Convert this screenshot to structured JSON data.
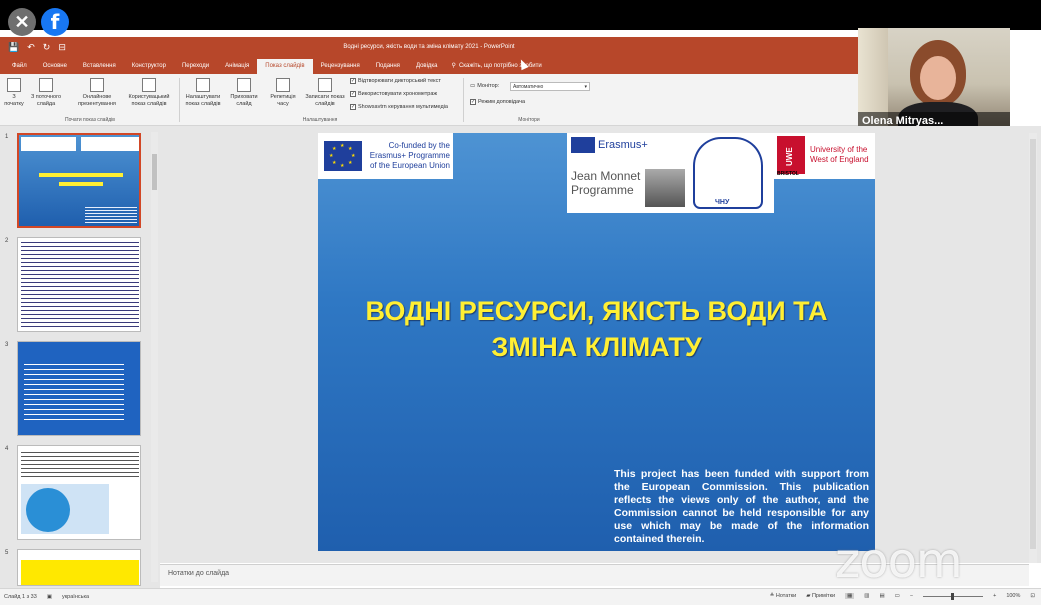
{
  "overlay": {
    "close_glyph": "✕",
    "facebook_glyph": "f"
  },
  "titlebar": {
    "quick_access": [
      "💾",
      "↶",
      "↻",
      "⊟"
    ],
    "document_title": "Водні ресурси, якість води та зміна клімату 2021  -  PowerPoint"
  },
  "ribbon_tabs": [
    {
      "label": "Файл"
    },
    {
      "label": "Основне"
    },
    {
      "label": "Вставлення"
    },
    {
      "label": "Конструктор"
    },
    {
      "label": "Переходи"
    },
    {
      "label": "Анімація"
    },
    {
      "label": "Показ слайдів",
      "active": true
    },
    {
      "label": "Рецензування"
    },
    {
      "label": "Подання"
    },
    {
      "label": "Довідка"
    }
  ],
  "tell_me": {
    "icon": "lightbulb-icon",
    "label": "Скажіть, що потрібно зробити"
  },
  "ribbon": {
    "start_group": {
      "buttons": [
        "З початку",
        "З поточного слайда",
        "Онлайнове презентування",
        "Користувацький показ слайдів"
      ],
      "label": "Почати показ слайдів"
    },
    "setup_group": {
      "buttons": [
        "Налаштувати показ слайдів",
        "Приховати слайд",
        "Репетиція часу",
        "Записати показ слайдів"
      ],
      "checkboxes": [
        "Відтворювати дикторський текст",
        "Використовувати хронометраж",
        "Showsavtrn керування мультимедіа"
      ],
      "label": "Налаштування"
    },
    "monitors_group": {
      "monitor_label": "Монітор:",
      "monitor_value": "Автоматично",
      "presenter_view": "Режим доповідача",
      "label": "Монітори"
    }
  },
  "video": {
    "participant_name": "Olena Mitryas..."
  },
  "thumbnails": [
    {
      "num": "1",
      "selected": true
    },
    {
      "num": "2"
    },
    {
      "num": "3"
    },
    {
      "num": "4"
    },
    {
      "num": "5"
    }
  ],
  "slide": {
    "eu_logo_text": "Co-funded by the\nErasmus+ Programme\nof the European Union",
    "erasmus_label": "Erasmus+",
    "jean_monnet": "Jean Monnet\nProgramme",
    "chnu_label": "ЧНУ",
    "uwe_abbr": "UWE",
    "uwe_city": "BRISTOL",
    "uwe_name": "University of the\nWest of England",
    "title_line1": "ВОДНІ РЕСУРСИ, ЯКІСТЬ ВОДИ ТА",
    "title_line2": "ЗМІНА КЛІМАТУ",
    "disclaimer": "This project has been funded with support from the European Commission. This publication reflects the views only of the author, and the Commission cannot be held responsible for any use which may be made of the information contained therein.",
    "background_color": "#2f78c4",
    "title_color": "#ffef33"
  },
  "notes": {
    "placeholder": "Нотатки до слайда"
  },
  "statusbar": {
    "slide_counter": "Слайд 1 з 33",
    "language": "українська",
    "notes_label": "Нотатки",
    "comments_label": "Примітки",
    "zoom_level": "100%"
  },
  "watermark": {
    "text": "zoom"
  },
  "colors": {
    "accent": "#b7472a",
    "selection": "#d24726"
  }
}
